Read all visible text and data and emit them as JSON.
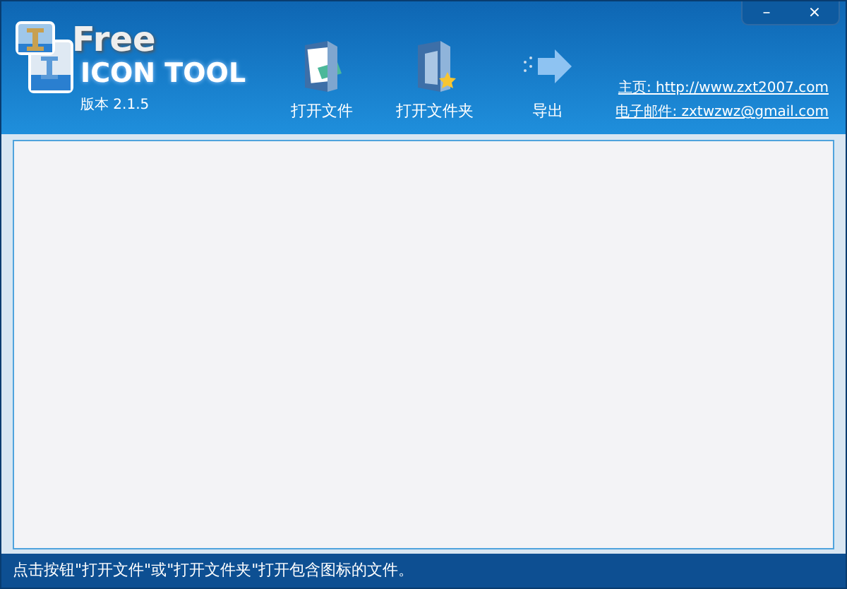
{
  "window": {
    "buttons": [
      "–",
      "×"
    ]
  },
  "logo": {
    "line_1": "Free",
    "line_2": "ICON TOOL",
    "version": "版本 2.1.5"
  },
  "toolbar": [
    {
      "label": "打开文件",
      "kind": "file"
    },
    {
      "label": "打开文件夹",
      "kind": "folder"
    },
    {
      "label": "导出",
      "kind": "export"
    }
  ],
  "links": [
    {
      "label": "主页:",
      "value": "http://www.zxt2007.com"
    },
    {
      "label": "电子邮件:",
      "value": "zxtwzwz@gmail.com"
    }
  ],
  "status_bar": "点击按钮\"打开文件\"或\"打开文件夹\"打开包含图标的文件。"
}
